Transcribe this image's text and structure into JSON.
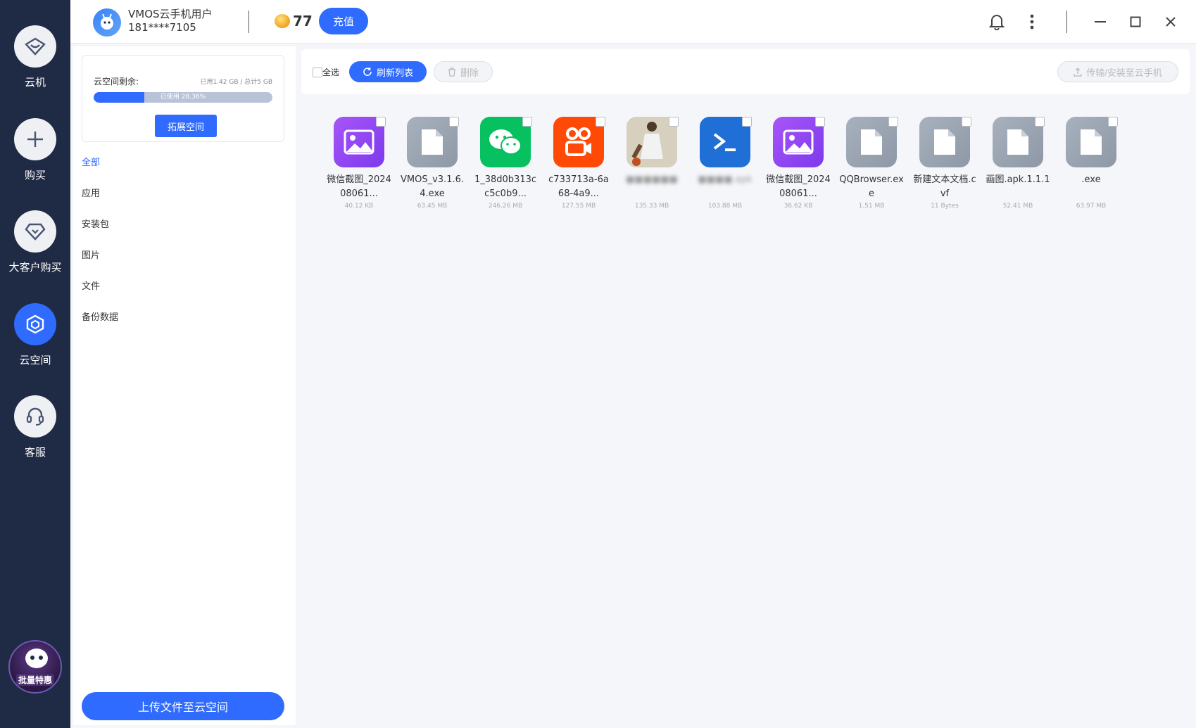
{
  "rail": {
    "items": [
      {
        "label": "云机",
        "icon": "cloud-phone-icon"
      },
      {
        "label": "购买",
        "icon": "plus-icon"
      },
      {
        "label": "大客户购买",
        "icon": "diamond-icon"
      },
      {
        "label": "云空间",
        "icon": "cube-icon",
        "active": true
      },
      {
        "label": "客服",
        "icon": "headset-icon"
      }
    ],
    "avatar_text": "批量特惠"
  },
  "header": {
    "user_name": "VMOS云手机用户",
    "user_phone": "181****7105",
    "coins": "77",
    "recharge_label": "充值"
  },
  "storage": {
    "title": "云空间剩余:",
    "usage_text": "已用1.42 GB / 总计5 GB",
    "used_fraction": 0.2836,
    "bar_text": "已使用 28.36%",
    "expand_label": "拓展空间"
  },
  "categories": [
    "全部",
    "应用",
    "安装包",
    "图片",
    "文件",
    "备份数据"
  ],
  "upload_label": "上传文件至云空间",
  "toolbar": {
    "select_all": "全选",
    "refresh": "刷新列表",
    "delete": "删除",
    "transfer": "传输/安装至云手机"
  },
  "files": [
    {
      "name": "微信截图_202408061...",
      "size": "40.12 KB",
      "type": "gallery"
    },
    {
      "name": "VMOS_v3.1.6.4.exe",
      "size": "63.45 MB",
      "type": "doc"
    },
    {
      "name": "1_38d0b313cc5c0b9...",
      "size": "246.26 MB",
      "type": "wechat"
    },
    {
      "name": "c733713a-6a68-4a9...",
      "size": "127.55 MB",
      "type": "kuaishou"
    },
    {
      "name": "■■■■■■",
      "size": "135.33 MB",
      "type": "photo",
      "blurred": true
    },
    {
      "name": "■■■■.apk",
      "size": "103.88 MB",
      "type": "ps",
      "blurred": true
    },
    {
      "name": "微信截图_202408061...",
      "size": "36.62 KB",
      "type": "gallery"
    },
    {
      "name": "QQBrowser.exe",
      "size": "1.51 MB",
      "type": "doc"
    },
    {
      "name": "新建文本文档.cvf",
      "size": "11 Bytes",
      "type": "doc"
    },
    {
      "name": "画图.apk.1.1.1",
      "size": "52.41 MB",
      "type": "doc"
    },
    {
      "name": ".exe",
      "size": "63.97 MB",
      "type": "doc"
    }
  ]
}
